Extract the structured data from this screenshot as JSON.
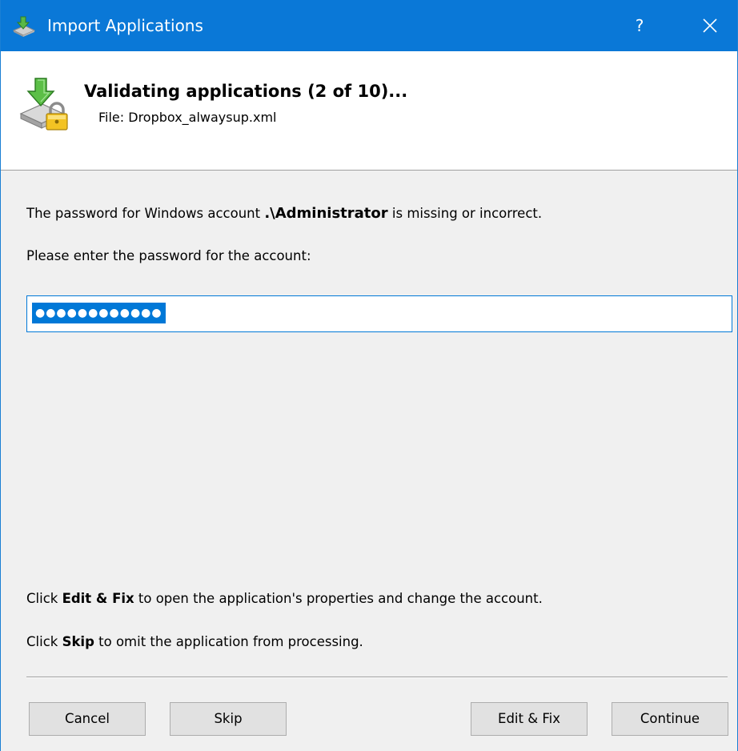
{
  "window": {
    "title": "Import Applications",
    "help_label": "?",
    "accent_color": "#0a78d7"
  },
  "banner": {
    "heading": "Validating applications (2 of 10)...",
    "file_line": "File: Dropbox_alwaysup.xml",
    "icon": "import-lock-icon"
  },
  "message": {
    "line1_prefix": "The password for Windows account ",
    "account": ".\\Administrator",
    "line1_suffix": " is missing or incorrect.",
    "prompt": "Please enter the password for the account:"
  },
  "password": {
    "masked_value": "●●●●●●●●●●●●"
  },
  "help_text": {
    "edit_prefix": "Click ",
    "edit_keyword": "Edit & Fix",
    "edit_suffix": " to open the application's properties and change the account.",
    "skip_prefix": "Click ",
    "skip_keyword": "Skip",
    "skip_suffix": " to omit the application from processing."
  },
  "buttons": {
    "cancel": "Cancel",
    "skip": "Skip",
    "edit_fix": "Edit & Fix",
    "continue": "Continue"
  }
}
